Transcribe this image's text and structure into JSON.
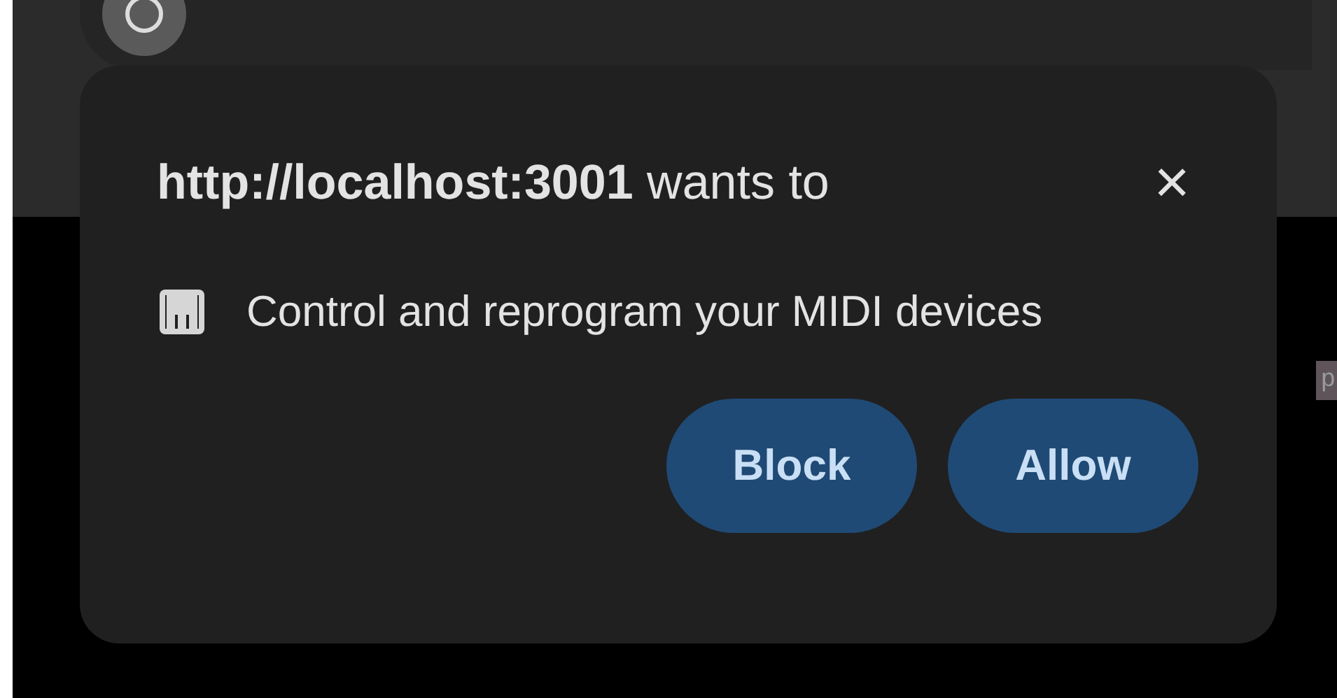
{
  "page": {
    "side_label": "p"
  },
  "permission_prompt": {
    "origin": "http://localhost:3001",
    "title_rest": "wants to",
    "close": "×",
    "permissions": [
      {
        "kind": "midi",
        "text": "Control and reprogram your MIDI devices"
      }
    ],
    "buttons": [
      {
        "label": "Block"
      },
      {
        "label": "Allow"
      }
    ]
  }
}
